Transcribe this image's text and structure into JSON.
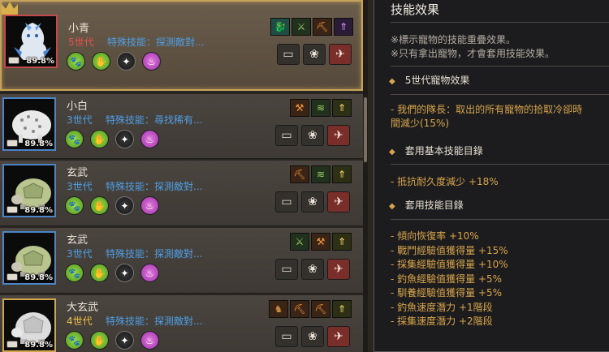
{
  "pets": [
    {
      "name": "小青",
      "generation": "5世代",
      "gen_color": "red",
      "skill": "特殊技能：探測敵對...",
      "ratio": "89.8%",
      "creature": "dragon",
      "selected": true,
      "skill_icons": [
        "dragon-skill-icon",
        "sword-skill-icon",
        "pickaxe-skill-icon",
        "purple-arrow-skill-icon"
      ]
    },
    {
      "name": "小白",
      "generation": "3世代",
      "gen_color": "blue",
      "skill": "特殊技能：尋找稀有...",
      "ratio": "89.8%",
      "creature": "snow-beast",
      "selected": false,
      "skill_icons": [
        "axe-skill-icon",
        "wing-skill-icon",
        "arrow-skill-icon"
      ]
    },
    {
      "name": "玄武",
      "generation": "3世代",
      "gen_color": "blue",
      "skill": "特殊技能：探測敵對...",
      "ratio": "89.8%",
      "creature": "turtle",
      "selected": false,
      "skill_icons": [
        "pickaxe-skill-icon",
        "wing-skill-icon",
        "arrow-skill-icon"
      ]
    },
    {
      "name": "玄武",
      "generation": "3世代",
      "gen_color": "blue",
      "skill": "特殊技能：探測敵對...",
      "ratio": "89.8%",
      "creature": "turtle",
      "selected": false,
      "skill_icons": [
        "sword-skill-icon",
        "axe-skill-icon",
        "arrow-skill-icon"
      ]
    },
    {
      "name": "大玄武",
      "generation": "4世代",
      "gen_color": "gold",
      "skill": "特殊技能：探測敵對...",
      "ratio": "89.8%",
      "creature": "turtle-white",
      "selected": false,
      "skill_icons": [
        "horse-skill-icon",
        "pickaxe-skill-icon",
        "pickaxe-skill-icon",
        "arrow-skill-icon"
      ]
    }
  ],
  "circle_icons": [
    "paw-growth-icon",
    "paw-speed-icon",
    "compass-icon",
    "potion-icon"
  ],
  "action_icons": [
    "feed-bowl-icon",
    "paw-icon",
    "release-icon"
  ],
  "tooltip": {
    "title": "技能效果",
    "note1": "※標示寵物的技能重疊效果。",
    "note2": "※只有拿出寵物，才會套用技能效果。",
    "section1": "5世代寵物效果",
    "section1_effect_line1": "- 我們的隊長：取出的所有寵物的拾取冷卻時",
    "section1_effect_line2": "間減少(15%)",
    "section2": "套用基本技能目錄",
    "section2_effect": "- 抵抗耐久度減少 +18%",
    "section3": "套用技能目錄",
    "section3_effects": [
      "- 傾向恢復率 +10%",
      "- 戰鬥經驗值獲得量 +15%",
      "- 採集經驗值獲得量 +10%",
      "- 釣魚經驗值獲得量 +5%",
      "- 馴養經驗值獲得量 +5%",
      "- 釣魚速度潛力 +1階段",
      "- 採集速度潛力 +2階段"
    ]
  },
  "colors": {
    "gen_red": "#e6524f",
    "gen_blue": "#4f9ee4",
    "gen_gold": "#f0c04a",
    "effect_orange": "#d9a54b",
    "selected_border": "#c7a25a"
  }
}
